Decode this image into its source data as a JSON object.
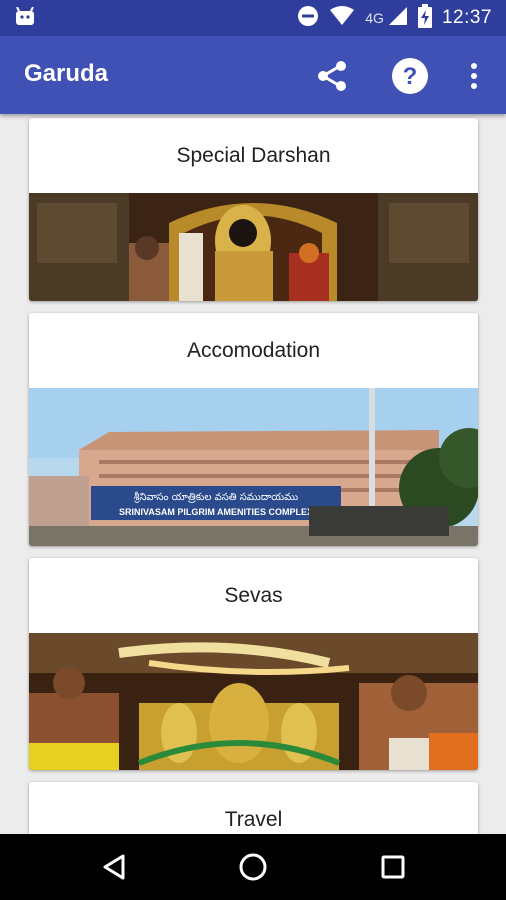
{
  "status_bar": {
    "network": "4G",
    "time": "12:37",
    "icons": [
      "android-icon",
      "do-not-disturb-icon",
      "wifi-icon",
      "cell-signal-icon",
      "battery-charging-icon"
    ]
  },
  "app_bar": {
    "title": "Garuda",
    "actions": [
      "share-icon",
      "help-icon",
      "more-vert-icon"
    ]
  },
  "cards": [
    {
      "title": "Special Darshan",
      "image": "deity-shrine-photo"
    },
    {
      "title": "Accomodation",
      "image": "amenities-complex-photo",
      "sign_telugu": "శ్రీనివాసం యాత్రికుల వసతి సముదాయము",
      "sign_text": "SRINIVASAM PILGRIM AMENITIES COMPLEX"
    },
    {
      "title": "Sevas",
      "image": "seva-ritual-photo"
    },
    {
      "title": "Travel"
    }
  ],
  "nav_bar": {
    "buttons": [
      "back-icon",
      "home-icon",
      "recents-icon"
    ]
  },
  "colors": {
    "status_bar": "#2f3d9c",
    "app_bar": "#3f51b5",
    "background": "#ececec"
  }
}
